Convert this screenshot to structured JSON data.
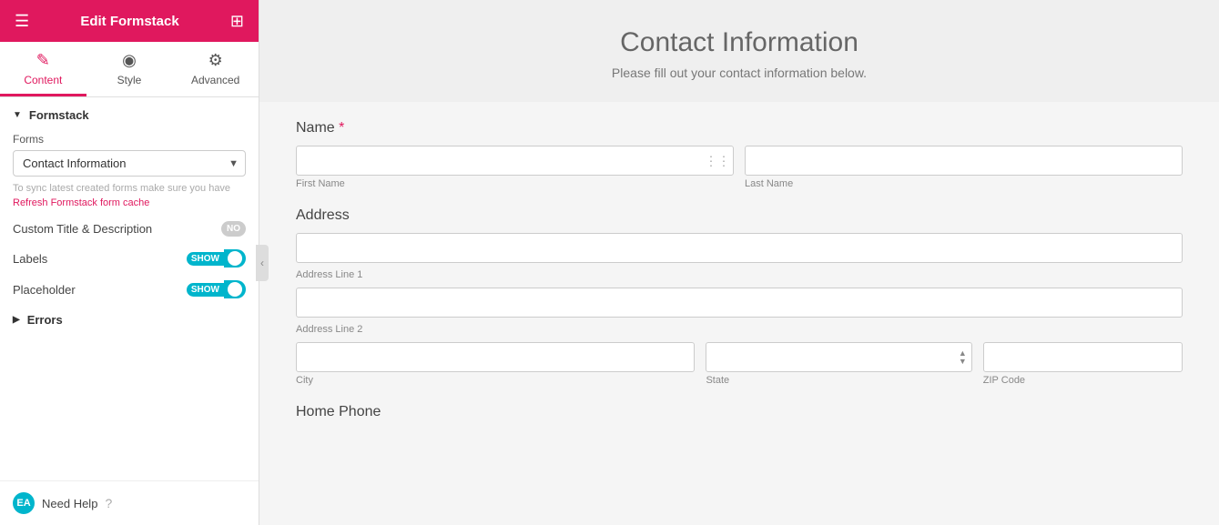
{
  "header": {
    "title": "Edit Formstack",
    "hamburger": "☰",
    "grid": "⊞"
  },
  "tabs": [
    {
      "id": "content",
      "label": "Content",
      "icon": "✎",
      "active": true
    },
    {
      "id": "style",
      "label": "Style",
      "icon": "◉",
      "active": false
    },
    {
      "id": "advanced",
      "label": "Advanced",
      "icon": "⚙",
      "active": false
    }
  ],
  "sidebar": {
    "formstack_section": "Formstack",
    "forms_label": "Forms",
    "forms_selected": "Contact Information",
    "sync_hint": "To sync latest created forms make sure you have",
    "refresh_link": "Refresh Formstack form cache",
    "custom_title_label": "Custom Title & Description",
    "labels_label": "Labels",
    "placeholder_label": "Placeholder",
    "errors_label": "Errors",
    "need_help": "Need Help",
    "help_badge": "EA"
  },
  "form": {
    "title": "Contact Information",
    "subtitle": "Please fill out your contact information below.",
    "name_label": "Name",
    "name_required": "*",
    "first_name_placeholder": "",
    "first_name_sub": "First Name",
    "last_name_placeholder": "",
    "last_name_sub": "Last Name",
    "address_label": "Address",
    "address_line1_placeholder": "",
    "address_line1_sub": "Address Line 1",
    "address_line2_placeholder": "",
    "address_line2_sub": "Address Line 2",
    "city_placeholder": "",
    "city_sub": "City",
    "state_placeholder": "",
    "state_sub": "State",
    "zip_placeholder": "",
    "zip_sub": "ZIP Code",
    "home_phone_label": "Home Phone"
  }
}
